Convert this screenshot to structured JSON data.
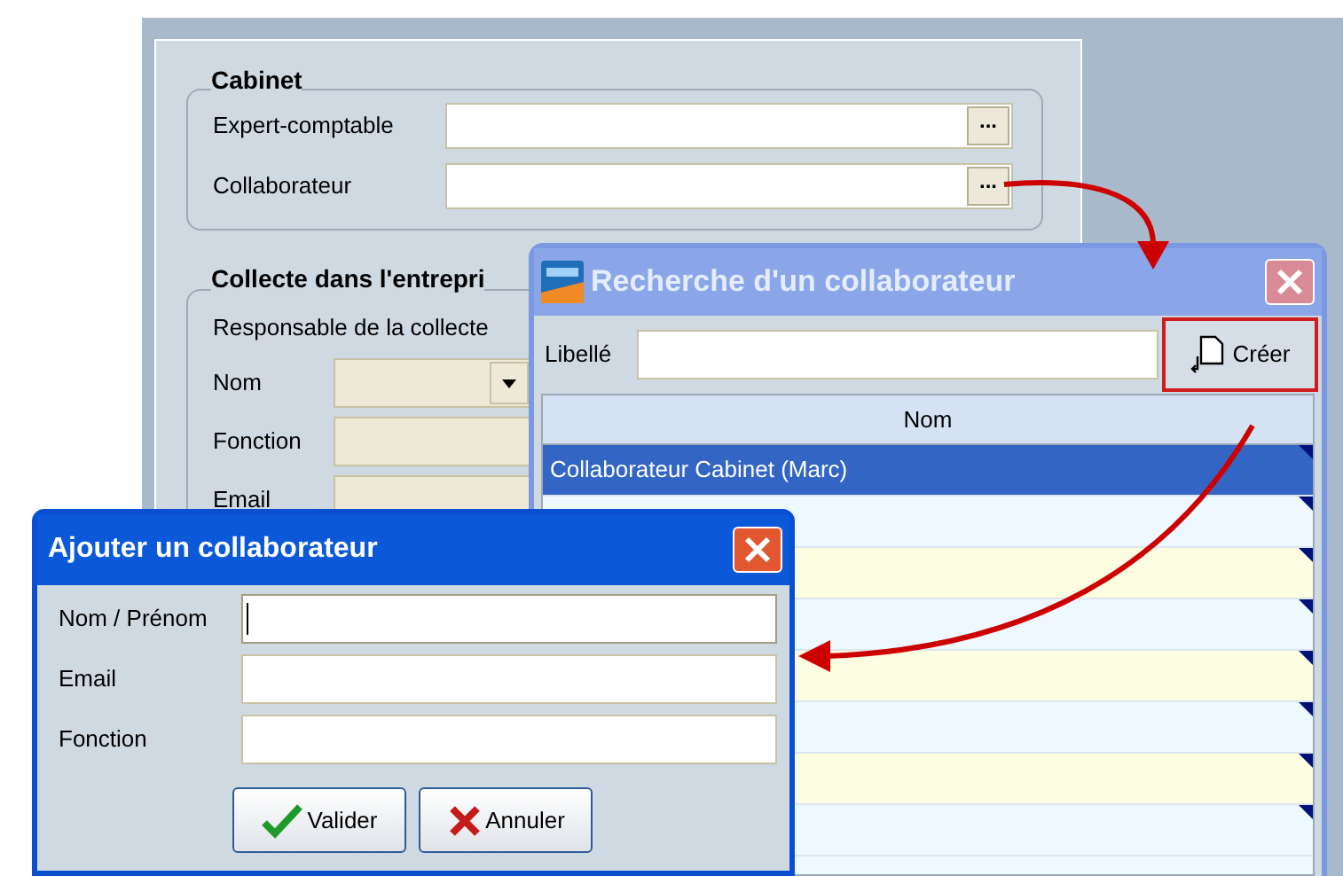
{
  "main_form": {
    "sections": [
      {
        "title": "Cabinet",
        "fields": [
          {
            "label": "Expert-comptable",
            "kind": "lookup",
            "button": "..."
          },
          {
            "label": "Collaborateur",
            "kind": "lookup",
            "button": "..."
          }
        ]
      },
      {
        "title": "Collecte dans l'entrepri",
        "subtitle": "Responsable de la collecte",
        "fields": [
          {
            "label": "Nom",
            "kind": "dropdown"
          },
          {
            "label": "Fonction",
            "kind": "text"
          },
          {
            "label": "Email",
            "kind": "text"
          }
        ]
      }
    ]
  },
  "search_window": {
    "title": "Recherche d'un collaborateur",
    "filter_label": "Libellé",
    "create_button": "Créer",
    "table": {
      "columns": [
        "Nom"
      ],
      "rows": [
        {
          "text": "Collaborateur Cabinet (Marc)",
          "selected": true
        },
        {
          "selected": false
        },
        {
          "selected": false
        },
        {
          "selected": false
        },
        {
          "selected": false
        },
        {
          "selected": false
        },
        {
          "selected": false
        },
        {
          "selected": false
        }
      ]
    }
  },
  "add_dialog": {
    "title": "Ajouter un collaborateur",
    "fields": [
      {
        "label": "Nom / Prénom",
        "focused": true
      },
      {
        "label": "Email",
        "focused": false
      },
      {
        "label": "Fonction",
        "focused": false
      }
    ],
    "buttons": [
      {
        "label": "Valider",
        "kind": "confirm"
      },
      {
        "label": "Annuler",
        "kind": "cancel"
      }
    ]
  }
}
